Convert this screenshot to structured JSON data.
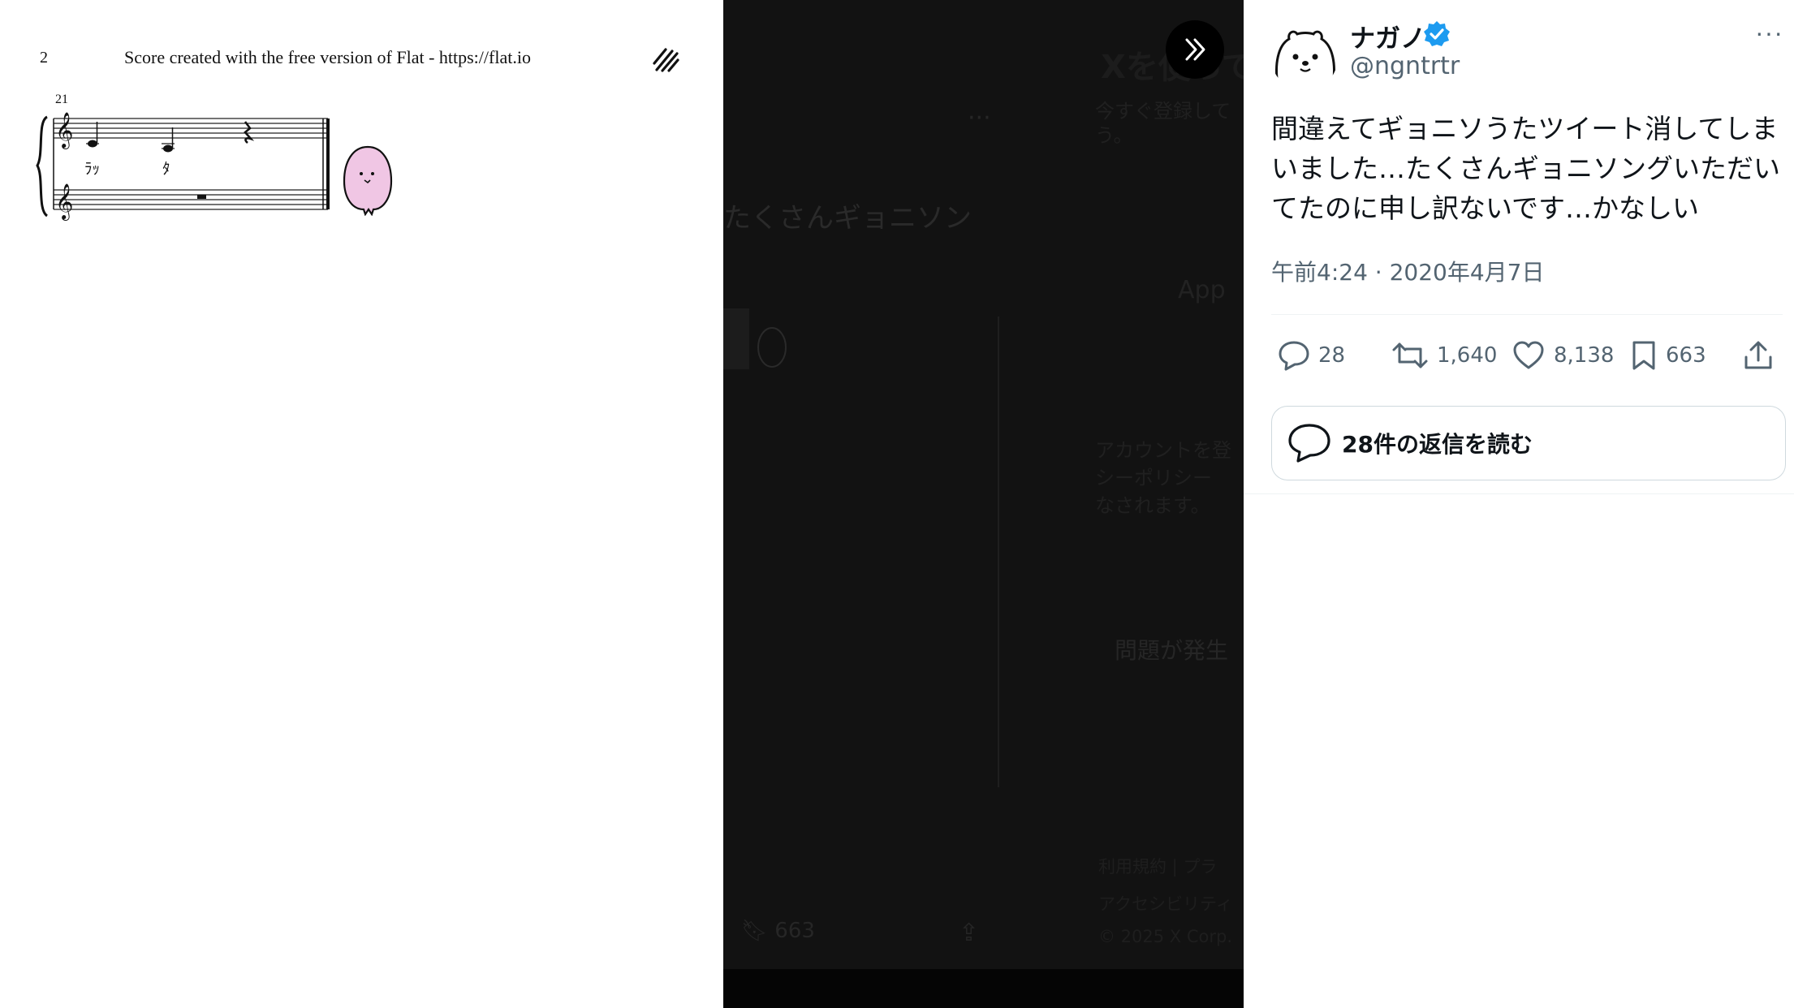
{
  "score": {
    "page_number": "2",
    "footer_text": "Score created with the free version of Flat - https://flat.io",
    "measure_number": "21",
    "lyric_1": "ﾗｯ",
    "lyric_2": "ﾀ"
  },
  "background_page": {
    "title": "Xを使ってみよう",
    "subtitle": "今すぐ登録して\nう。",
    "tweet_snippet": "たくさんギョニソン",
    "apple_button": "App",
    "legal": "アカウントを登\nシーポリシー\nなされます。",
    "error": "問題が発生",
    "terms": "利用規約 | プラ",
    "accessibility": "アクセシビリティ",
    "copyright": "© 2025 X Corp.",
    "bookmarks": "663"
  },
  "tweet": {
    "display_name": "ナガノ",
    "handle": "@ngntrtr",
    "text": "間違えてギョニソうたツイート消してしまいました…たくさんギョニソングいただいてたのに申し訳ないです…かなしい",
    "timestamp": "午前4:24 · 2020年4月7日",
    "stats": {
      "replies": "28",
      "retweets": "1,640",
      "likes": "8,138",
      "bookmarks": "663"
    },
    "read_replies_label": "28件の返信を読む"
  },
  "colors": {
    "verified": "#1d9bf0",
    "secondary_text": "#536471",
    "overlay": "#121212",
    "blob_fill": "#f0c6e4"
  },
  "icons": {
    "collapse": "double-chevron-right-icon",
    "reply": "reply-bubble-icon",
    "retweet": "retweet-icon",
    "like": "heart-icon",
    "bookmark": "bookmark-icon",
    "share": "share-upload-icon",
    "more": "more-dots-icon"
  }
}
